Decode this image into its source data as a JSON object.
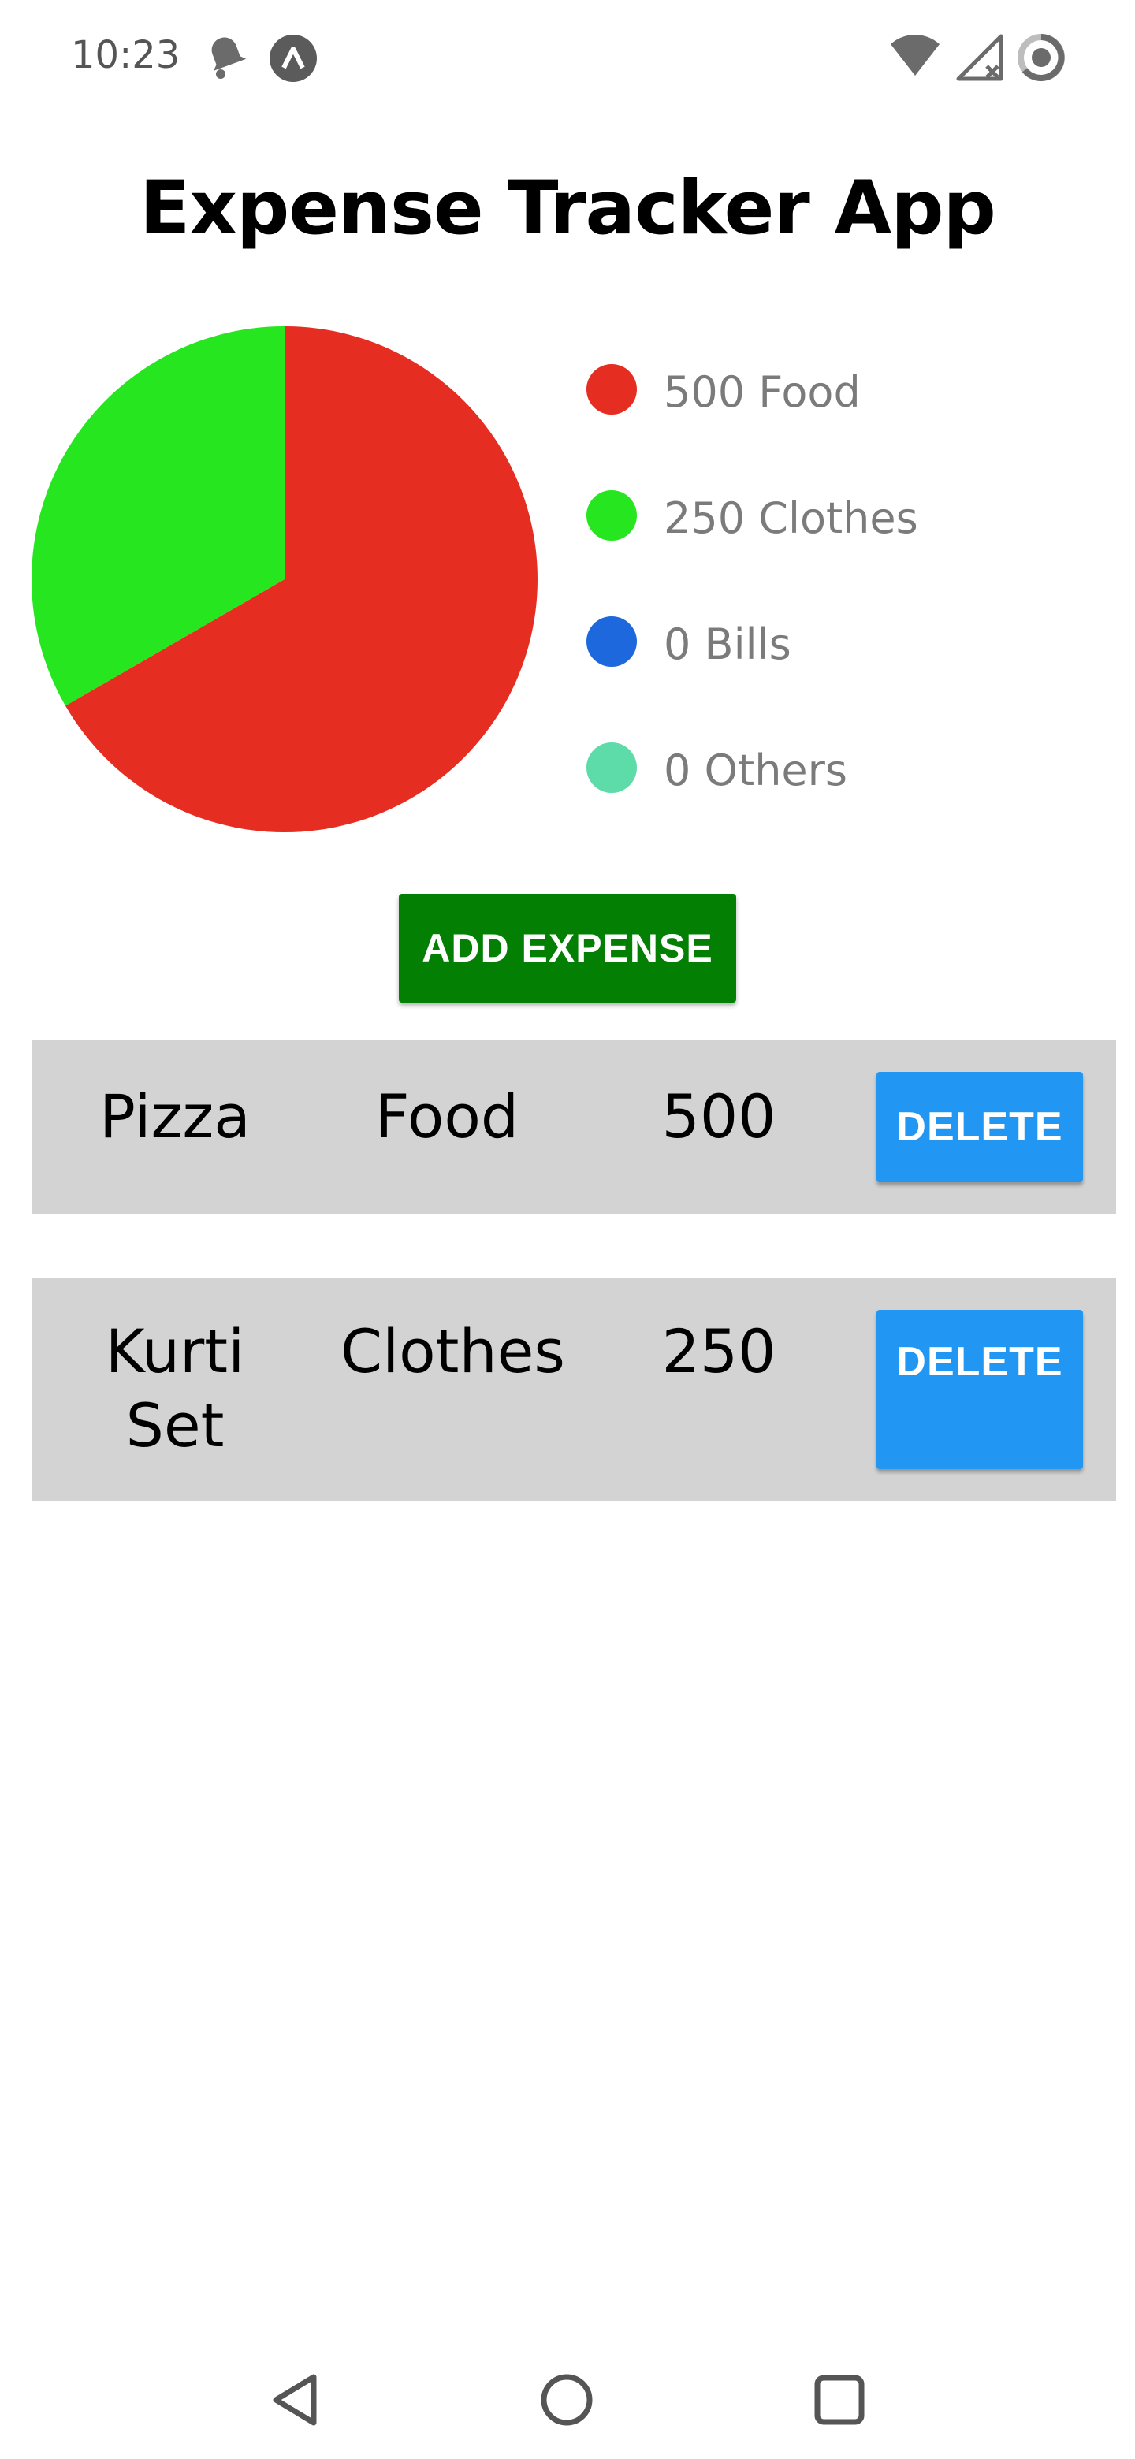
{
  "status_bar": {
    "time": "10:23",
    "left_icons": [
      "notification-bell-icon",
      "app-a-icon"
    ],
    "right_icons": [
      "wifi-icon",
      "signal-no-service-icon",
      "battery-icon"
    ]
  },
  "app": {
    "title": "Expense Tracker App"
  },
  "chart_data": {
    "type": "pie",
    "slices": [
      {
        "category": "Food",
        "value": 500,
        "color": "#e62d22"
      },
      {
        "category": "Clothes",
        "value": 250,
        "color": "#26e620"
      },
      {
        "category": "Bills",
        "value": 0,
        "color": "#1c68dc"
      },
      {
        "category": "Others",
        "value": 0,
        "color": "#5ddba8"
      }
    ],
    "legend": [
      {
        "label": "500 Food",
        "color": "#e62d22"
      },
      {
        "label": "250 Clothes",
        "color": "#26e620"
      },
      {
        "label": "0 Bills",
        "color": "#1c68dc"
      },
      {
        "label": "0 Others",
        "color": "#5ddba8"
      }
    ],
    "legend_placement": "right"
  },
  "actions": {
    "add_expense_label": "ADD EXPENSE"
  },
  "expenses": [
    {
      "name": "Pizza",
      "category": "Food",
      "amount": "500",
      "delete_label": "DELETE"
    },
    {
      "name": "Kurti Set",
      "category": "Clothes",
      "amount": "250",
      "delete_label": "DELETE"
    }
  ],
  "nav_bar": {
    "icons": [
      "back-icon",
      "home-icon",
      "recents-icon"
    ]
  },
  "colors": {
    "add_button": "#037f04",
    "delete_button": "#2196f3",
    "row_background": "#d3d3d3"
  }
}
